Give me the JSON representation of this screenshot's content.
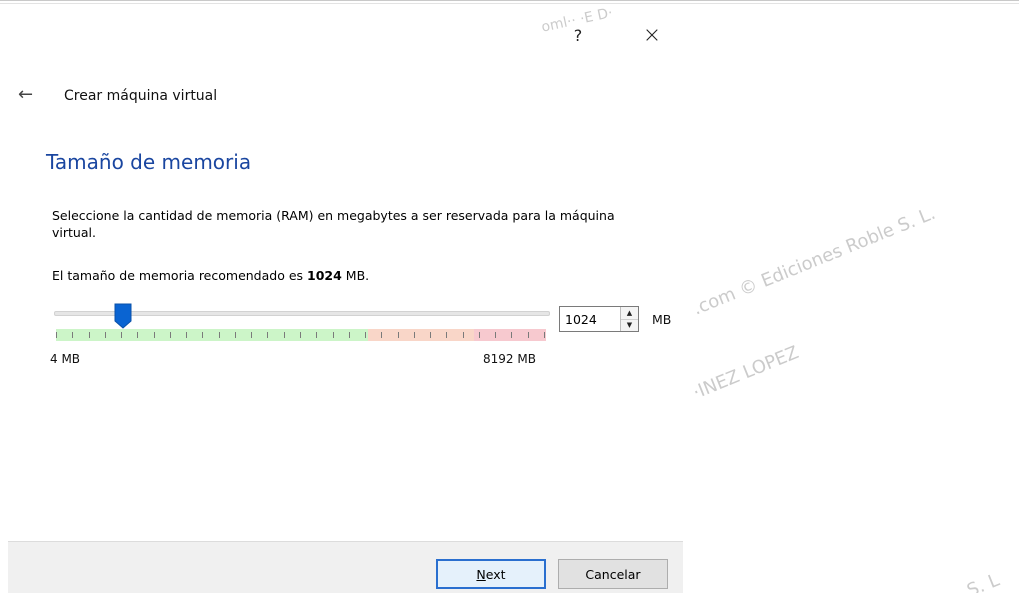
{
  "window": {
    "help_label": "?",
    "close_label": "×"
  },
  "wizard": {
    "back_label": "←",
    "title": "Crear máquina virtual"
  },
  "page": {
    "section_title": "Tamaño de memoria",
    "description": "Seleccione la cantidad de memoria (RAM) en megabytes a ser reservada para la máquina virtual.",
    "recommended_prefix": "El tamaño de memoria recomendado es ",
    "recommended_value": "1024",
    "recommended_suffix": " MB."
  },
  "memory": {
    "min_label": "4 MB",
    "max_label": "8192 MB",
    "min_value": 4,
    "max_value": 8192,
    "current_value": 1024,
    "value_text": "1024",
    "unit": "MB",
    "spin_up": "▲",
    "spin_down": "▼",
    "colors": {
      "handle": "#0a64d2",
      "safe_band": "#ccf5c8",
      "warn_band": "#f9d6c8",
      "danger_band": "#f7c9cf"
    }
  },
  "footer": {
    "next_label": "Next",
    "cancel_label": "Cancelar"
  },
  "watermark": {
    "line1": ".com © Ediciones Roble S. L.",
    "line2": "·INEZ LOPEZ",
    "line3": "oml·· ·E D·",
    "line4": "S. L"
  }
}
